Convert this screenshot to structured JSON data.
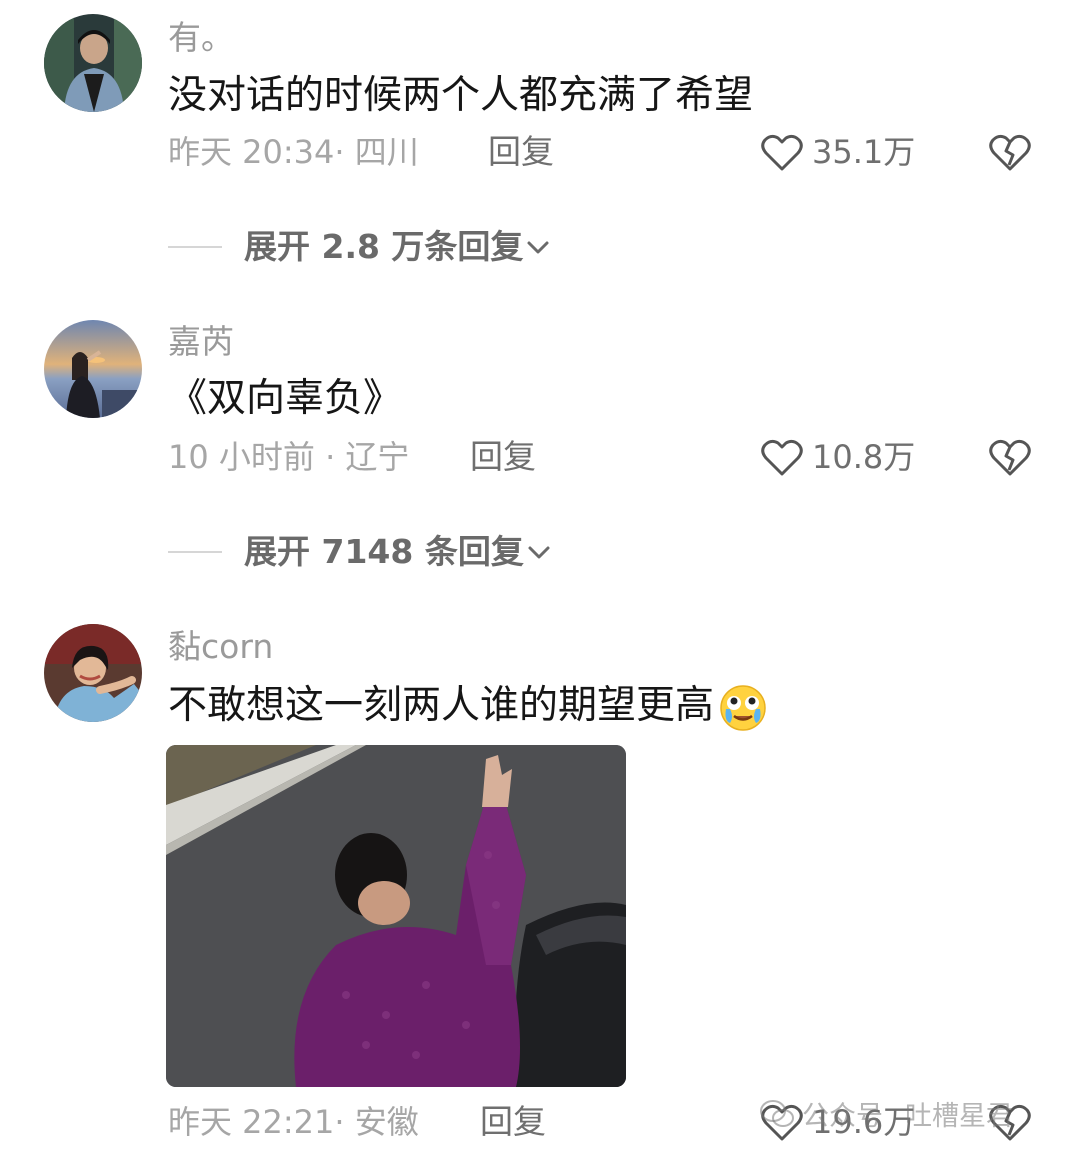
{
  "comments": [
    {
      "username": "有。",
      "content": "没对话的时候两个人都充满了希望",
      "meta": "昨天 20:34· 四川",
      "reply_label": "回复",
      "like_count": "35.1万",
      "expand_text": "展开 2.8 万条回复"
    },
    {
      "username": "嘉芮",
      "content": "《双向辜负》",
      "meta": "10 小时前 · 辽宁",
      "reply_label": "回复",
      "like_count": "10.8万",
      "expand_text": "展开 7148 条回复"
    },
    {
      "username": "黏corn",
      "content": "不敢想这一刻两人谁的期望更高",
      "meta": "昨天 22:21· 安徽",
      "reply_label": "回复",
      "like_count": "19.6万"
    }
  ],
  "watermark": {
    "label": "公众号",
    "name": "吐槽星君"
  },
  "icons": {
    "like": "heart-outline-icon",
    "dislike": "broken-heart-icon",
    "expand": "chevron-down-icon",
    "emoji": "teary-laugh-emoji-icon",
    "watermark": "wechat-icon"
  },
  "colors": {
    "meta_text": "#a6a6a6",
    "username_text": "#9a9a9a",
    "content_text": "#161616"
  }
}
